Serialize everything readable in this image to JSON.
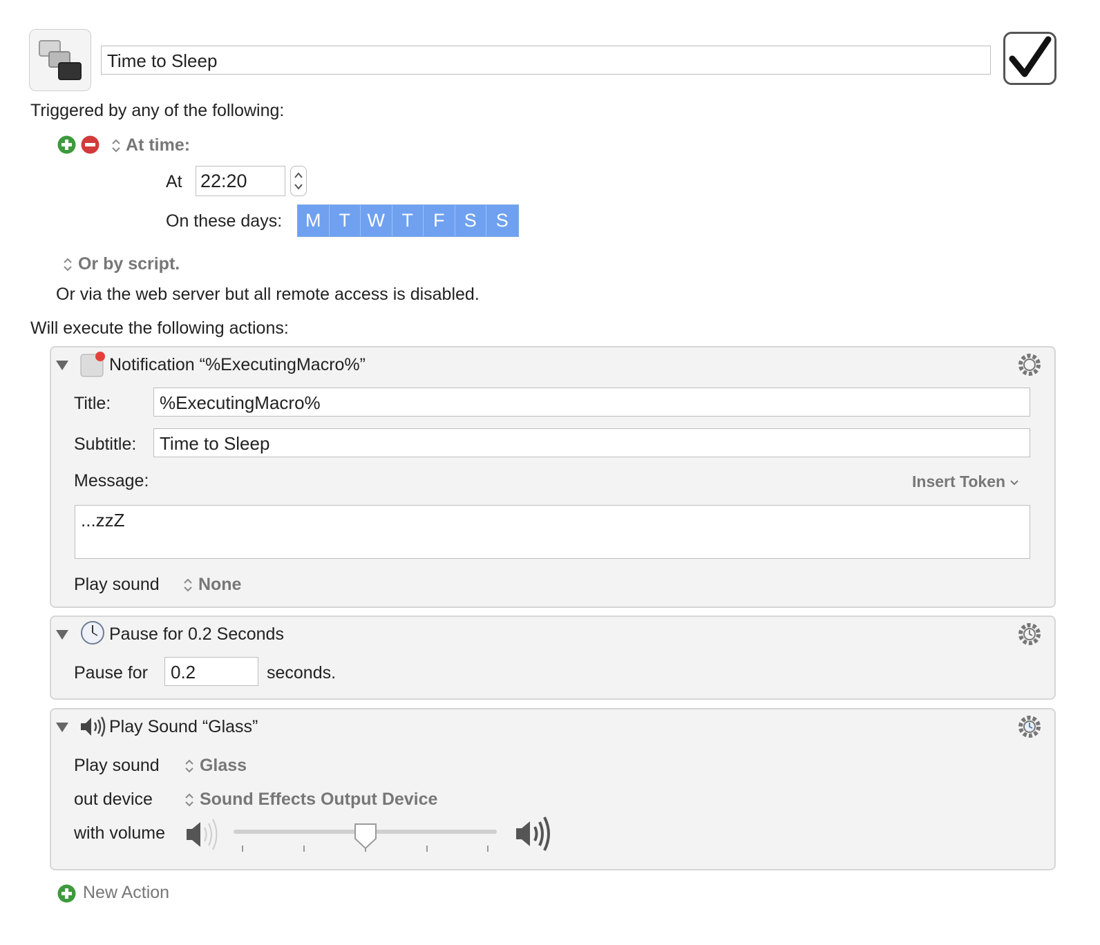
{
  "macro": {
    "name": "Time to Sleep",
    "icon": "macro-screens-icon",
    "enabled_icon": "checkmark-icon"
  },
  "triggers": {
    "heading": "Triggered by any of the following:",
    "add_icon": "plus-circle-icon",
    "remove_icon": "minus-circle-icon",
    "trigger_type": "At time:",
    "at_label": "At",
    "time_value": "22:20",
    "days_label": "On these days:",
    "days": [
      "M",
      "T",
      "W",
      "T",
      "F",
      "S",
      "S"
    ],
    "script_option": "Or by script.",
    "web_server_text": "Or via the web server but all remote access is disabled."
  },
  "actions_heading": "Will execute the following actions:",
  "actions": {
    "notification": {
      "header": "Notification “%ExecutingMacro%”",
      "title_label": "Title:",
      "title_value": "%ExecutingMacro%",
      "subtitle_label": "Subtitle:",
      "subtitle_value": "Time to Sleep",
      "message_label": "Message:",
      "insert_token": "Insert Token",
      "message_value": "...zzZ",
      "play_sound_label": "Play sound",
      "play_sound_value": "None"
    },
    "pause": {
      "header": "Pause for 0.2 Seconds",
      "pause_label": "Pause for",
      "pause_value": "0.2",
      "seconds_label": "seconds."
    },
    "play_sound": {
      "header": "Play Sound “Glass”",
      "play_sound_label": "Play sound",
      "play_sound_value": "Glass",
      "out_device_label": "out device",
      "out_device_value": "Sound Effects Output Device",
      "volume_label": "with volume",
      "volume_fraction": 0.5
    }
  },
  "new_action": "New Action",
  "colors": {
    "accent_blue": "#6fa1f0",
    "add_green": "#3d9a3d",
    "remove_red": "#d23b3b"
  }
}
